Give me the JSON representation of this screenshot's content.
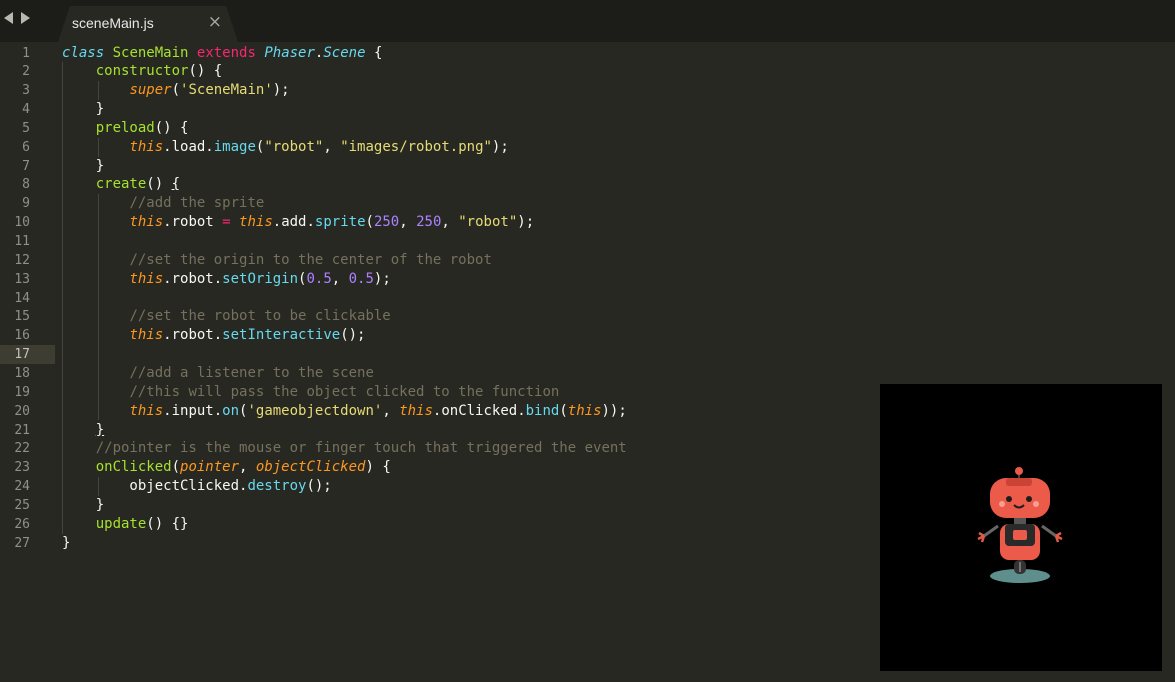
{
  "tab": {
    "filename": "sceneMain.js"
  },
  "editor": {
    "active_line": 17,
    "lines": [
      [
        [
          "st",
          "class"
        ],
        [
          "p",
          " "
        ],
        [
          "cls",
          "SceneMain"
        ],
        [
          "p",
          " "
        ],
        [
          "kw",
          "extends"
        ],
        [
          "p",
          " "
        ],
        [
          "ty",
          "Phaser"
        ],
        [
          "p",
          "."
        ],
        [
          "ty",
          "Scene"
        ],
        [
          "p",
          " {"
        ]
      ],
      [
        [
          "p",
          "    "
        ],
        [
          "fn",
          "constructor"
        ],
        [
          "p",
          "() {"
        ]
      ],
      [
        [
          "p",
          "        "
        ],
        [
          "th",
          "super"
        ],
        [
          "p",
          "("
        ],
        [
          "str",
          "'SceneMain'"
        ],
        [
          "p",
          ");"
        ]
      ],
      [
        [
          "p",
          "    }"
        ]
      ],
      [
        [
          "p",
          "    "
        ],
        [
          "fn",
          "preload"
        ],
        [
          "p",
          "() {"
        ]
      ],
      [
        [
          "p",
          "        "
        ],
        [
          "th",
          "this"
        ],
        [
          "p",
          ".load."
        ],
        [
          "mt",
          "image"
        ],
        [
          "p",
          "("
        ],
        [
          "str",
          "\"robot\""
        ],
        [
          "p",
          ", "
        ],
        [
          "str",
          "\"images/robot.png\""
        ],
        [
          "p",
          ");"
        ]
      ],
      [
        [
          "p",
          "    }"
        ]
      ],
      [
        [
          "p",
          "    "
        ],
        [
          "fn",
          "create"
        ],
        [
          "p",
          "() "
        ],
        [
          "ul",
          "{"
        ]
      ],
      [
        [
          "p",
          "        "
        ],
        [
          "cm",
          "//add the sprite"
        ]
      ],
      [
        [
          "p",
          "        "
        ],
        [
          "th",
          "this"
        ],
        [
          "p",
          ".robot "
        ],
        [
          "kw",
          "="
        ],
        [
          "p",
          " "
        ],
        [
          "th",
          "this"
        ],
        [
          "p",
          ".add."
        ],
        [
          "mt",
          "sprite"
        ],
        [
          "p",
          "("
        ],
        [
          "num",
          "250"
        ],
        [
          "p",
          ", "
        ],
        [
          "num",
          "250"
        ],
        [
          "p",
          ", "
        ],
        [
          "str",
          "\"robot\""
        ],
        [
          "p",
          ");"
        ]
      ],
      [],
      [
        [
          "p",
          "        "
        ],
        [
          "cm",
          "//set the origin to the center of the robot"
        ]
      ],
      [
        [
          "p",
          "        "
        ],
        [
          "th",
          "this"
        ],
        [
          "p",
          ".robot."
        ],
        [
          "mt",
          "setOrigin"
        ],
        [
          "p",
          "("
        ],
        [
          "num",
          "0.5"
        ],
        [
          "p",
          ", "
        ],
        [
          "num",
          "0.5"
        ],
        [
          "p",
          ");"
        ]
      ],
      [],
      [
        [
          "p",
          "        "
        ],
        [
          "cm",
          "//set the robot to be clickable"
        ]
      ],
      [
        [
          "p",
          "        "
        ],
        [
          "th",
          "this"
        ],
        [
          "p",
          ".robot."
        ],
        [
          "mt",
          "setInteractive"
        ],
        [
          "p",
          "();"
        ]
      ],
      [],
      [
        [
          "p",
          "        "
        ],
        [
          "cm",
          "//add a listener to the scene"
        ]
      ],
      [
        [
          "p",
          "        "
        ],
        [
          "cm",
          "//this will pass the object clicked to the function"
        ]
      ],
      [
        [
          "p",
          "        "
        ],
        [
          "th",
          "this"
        ],
        [
          "p",
          ".input."
        ],
        [
          "mt",
          "on"
        ],
        [
          "p",
          "("
        ],
        [
          "str",
          "'gameobjectdown'"
        ],
        [
          "p",
          ", "
        ],
        [
          "th",
          "this"
        ],
        [
          "p",
          ".onClicked."
        ],
        [
          "mt",
          "bind"
        ],
        [
          "p",
          "("
        ],
        [
          "th",
          "this"
        ],
        [
          "p",
          "));"
        ]
      ],
      [
        [
          "p",
          "    "
        ],
        [
          "ul",
          "}"
        ]
      ],
      [
        [
          "p",
          "    "
        ],
        [
          "cm",
          "//pointer is the mouse or finger touch that triggered the event"
        ]
      ],
      [
        [
          "p",
          "    "
        ],
        [
          "fn",
          "onClicked"
        ],
        [
          "p",
          "("
        ],
        [
          "pa",
          "pointer"
        ],
        [
          "p",
          ", "
        ],
        [
          "pa",
          "objectClicked"
        ],
        [
          "p",
          ") {"
        ]
      ],
      [
        [
          "p",
          "        objectClicked."
        ],
        [
          "mt",
          "destroy"
        ],
        [
          "p",
          "();"
        ]
      ],
      [
        [
          "p",
          "    }"
        ]
      ],
      [
        [
          "p",
          "    "
        ],
        [
          "fn",
          "update"
        ],
        [
          "p",
          "() {}"
        ]
      ],
      [
        [
          "p",
          "}"
        ]
      ]
    ]
  },
  "preview": {
    "sprite": "robot-sprite"
  }
}
